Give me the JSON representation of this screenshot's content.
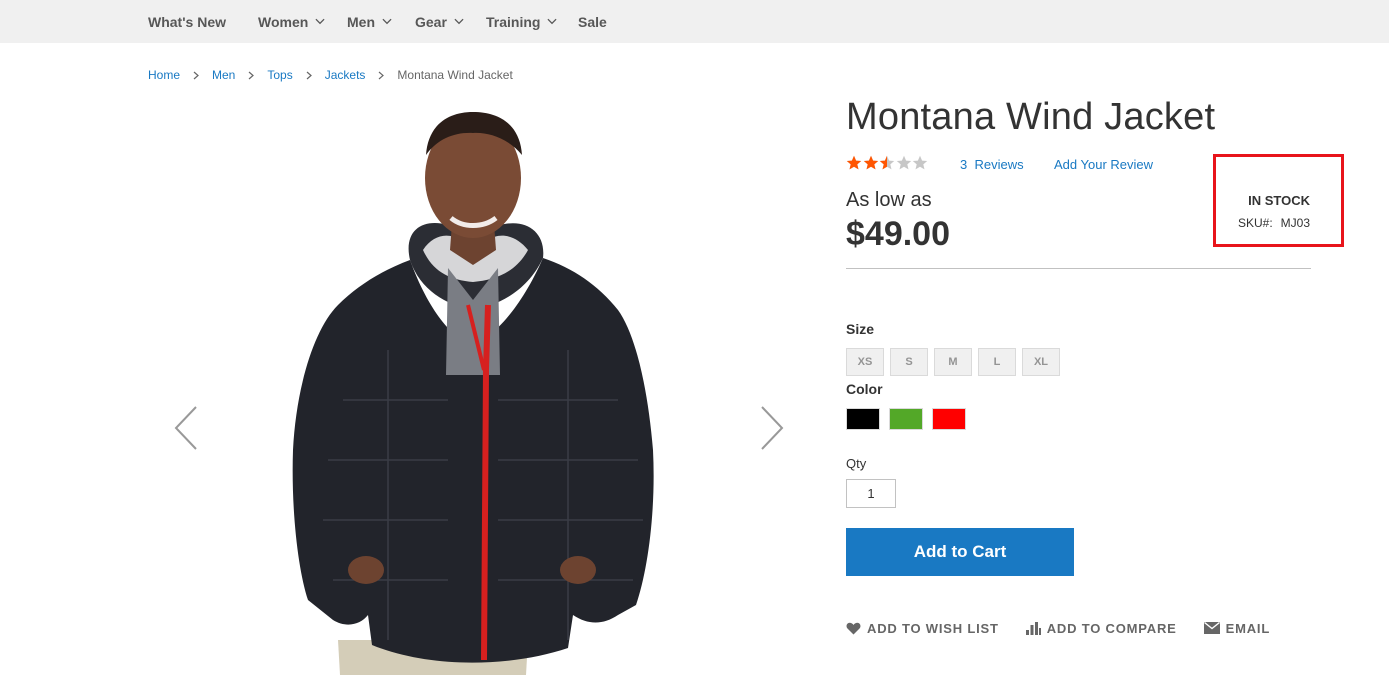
{
  "nav": {
    "items": [
      {
        "label": "What's New",
        "has_dropdown": false
      },
      {
        "label": "Women",
        "has_dropdown": true
      },
      {
        "label": "Men",
        "has_dropdown": true
      },
      {
        "label": "Gear",
        "has_dropdown": true
      },
      {
        "label": "Training",
        "has_dropdown": true
      },
      {
        "label": "Sale",
        "has_dropdown": false
      }
    ]
  },
  "breadcrumbs": [
    "Home",
    "Men",
    "Tops",
    "Jackets",
    "Montana Wind Jacket"
  ],
  "product": {
    "name": "Montana Wind Jacket",
    "rating": {
      "stars_filled": 2.5,
      "stars_total": 5,
      "color": "#ff5501"
    },
    "reviews_count": "3",
    "reviews_label": "Reviews",
    "add_review": "Add Your Review",
    "price_prefix": "As low as",
    "price": "$49.00",
    "stock": "IN STOCK",
    "sku_label": "SKU#:",
    "sku": "MJ03"
  },
  "options": {
    "size_label": "Size",
    "sizes": [
      "XS",
      "S",
      "M",
      "L",
      "XL"
    ],
    "color_label": "Color",
    "colors": [
      "#000000",
      "#53a828",
      "#ff0000"
    ],
    "qty_label": "Qty",
    "qty_value": "1"
  },
  "cart": {
    "button": "Add to Cart"
  },
  "actions": [
    {
      "label": "ADD TO WISH LIST",
      "icon": "heart-icon"
    },
    {
      "label": "ADD TO COMPARE",
      "icon": "compare-chart-icon"
    },
    {
      "label": "EMAIL",
      "icon": "envelope-icon"
    }
  ],
  "colors": {
    "link": "#1979c3",
    "primary_button": "#1979c3",
    "highlight_box": "#e8141b",
    "nav_bg": "#f0f0f0"
  }
}
